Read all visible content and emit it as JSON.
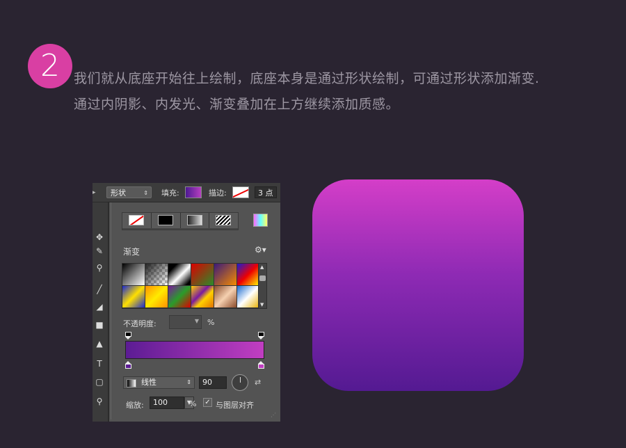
{
  "step": {
    "number": "2"
  },
  "description": {
    "line1": "我们就从底座开始往上绘制，底座本身是通过形状绘制，可通过形状添加渐变.",
    "line2": "通过内阴影、内发光、渐变叠加在上方继续添加质感。"
  },
  "options_bar": {
    "shape_mode": "形状",
    "fill_label": "填充:",
    "stroke_label": "描边:",
    "stroke_width": "3 点"
  },
  "fill_panel": {
    "section_title": "渐变",
    "opacity_label": "不透明度:",
    "percent_sign": "%",
    "style_value": "线性",
    "angle_value": "90",
    "scale_label": "缩放:",
    "scale_value": "100",
    "align_label": "与图层对齐",
    "align_checked": true,
    "gradient_start_color": "#5c1c94",
    "gradient_end_color": "#c13ec1"
  },
  "icon_preview": {
    "top_color": "#d43ec8",
    "bottom_color": "#541a92"
  }
}
